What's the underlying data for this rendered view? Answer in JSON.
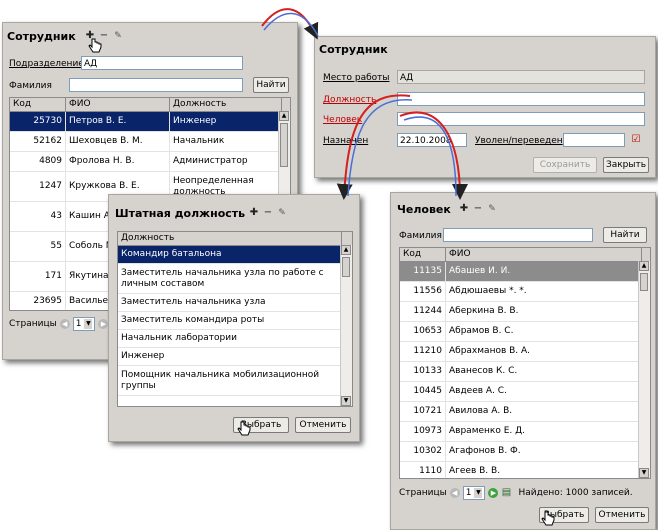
{
  "employee": {
    "title": "Сотрудник",
    "dept_label": "Подразделение",
    "dept_value": "АД",
    "surname_label": "Фамилия",
    "surname_value": "",
    "find": "Найти",
    "cols": [
      "Код",
      "ФИО",
      "Должность"
    ],
    "rows": [
      {
        "code": "25730",
        "name": "Петров В. Е.",
        "pos": "Инженер",
        "selected": true
      },
      {
        "code": "52162",
        "name": "Шеховцев В. М.",
        "pos": "Начальник"
      },
      {
        "code": "4809",
        "name": "Фролова Н. В.",
        "pos": "Администратор"
      },
      {
        "code": "1247",
        "name": "Кружкова В. Е.",
        "pos": "Неопределенная должность"
      },
      {
        "code": "43",
        "name": "Кашин А",
        "pos": ""
      },
      {
        "code": "55",
        "name": "Соболь М",
        "pos": ""
      },
      {
        "code": "171",
        "name": "Якутина",
        "pos": ""
      },
      {
        "code": "23695",
        "name": "Васильев",
        "pos": ""
      }
    ],
    "pages_label": "Страницы",
    "page": "1"
  },
  "detail": {
    "title": "Сотрудник",
    "workplace_label": "Место работы",
    "workplace_value": "АД",
    "position_label": "Должность",
    "person_label": "Человек",
    "assigned_label": "Назначен",
    "assigned_value": "22.10.2008",
    "fired_label": "Уволен/переведен",
    "save": "Сохранить",
    "close": "Закрыть"
  },
  "position": {
    "title": "Штатная должность",
    "col": "Должность",
    "rows": [
      {
        "name": "Командир батальона",
        "selected": true
      },
      {
        "name": "Заместитель начальника узла по работе с личным составом"
      },
      {
        "name": "Заместитель начальника узла"
      },
      {
        "name": "Заместитель командира роты"
      },
      {
        "name": "Начальник лаборатории"
      },
      {
        "name": "Инженер"
      },
      {
        "name": "Помощник начальника мобилизационной группы"
      }
    ],
    "choose": "Выбрать",
    "cancel": "Отменить"
  },
  "person": {
    "title": "Человек",
    "surname_label": "Фамилия",
    "find": "Найти",
    "cols": [
      "Код",
      "ФИО"
    ],
    "rows": [
      {
        "code": "11135",
        "name": "Абашев И. И.",
        "selected": true
      },
      {
        "code": "11556",
        "name": "Абдюшаевы *. *."
      },
      {
        "code": "11244",
        "name": "Аберкина В. В."
      },
      {
        "code": "10653",
        "name": "Абрамов В. С."
      },
      {
        "code": "11210",
        "name": "Абрахманов В. А."
      },
      {
        "code": "10133",
        "name": "Аванесов К. С."
      },
      {
        "code": "10445",
        "name": "Авдеев А. С."
      },
      {
        "code": "10721",
        "name": "Авилова А. В."
      },
      {
        "code": "10973",
        "name": "Авраменко Е. Д."
      },
      {
        "code": "10302",
        "name": "Агафонов В. Ф."
      },
      {
        "code": "1110",
        "name": "Агеев В. В."
      }
    ],
    "pages_label": "Страницы",
    "page": "1",
    "found": "Найдено: 1000 записей.",
    "choose": "Выбрать",
    "cancel": "Отменить"
  },
  "icons": {
    "add": "plus-icon",
    "remove": "minus-icon",
    "edit": "edit-icon",
    "arrow_color_red": "#d42020",
    "arrow_color_blue": "#4a6fd6"
  }
}
